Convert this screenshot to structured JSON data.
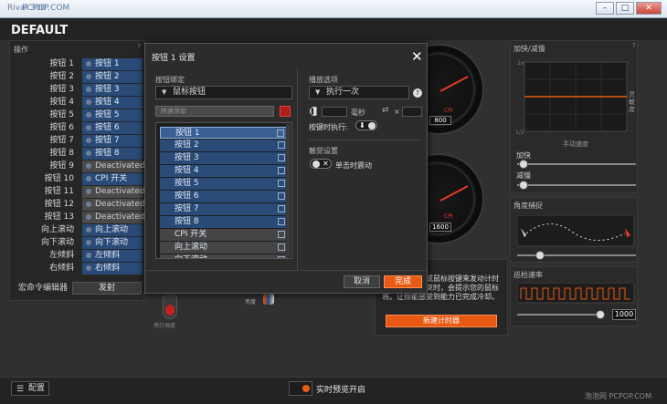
{
  "window": {
    "title": "Rival 300",
    "watermark_small": "PCPOP.COM",
    "watermark_big": "泡泡网 PCPOP.COM"
  },
  "profile": {
    "name": "DEFAULT"
  },
  "left_panel": {
    "header": "操作",
    "rows": [
      {
        "name": "按钮 1",
        "value": "按钮 1",
        "grey": false
      },
      {
        "name": "按钮 2",
        "value": "按钮 2",
        "grey": false
      },
      {
        "name": "按钮 3",
        "value": "按钮 3",
        "grey": false
      },
      {
        "name": "按钮 4",
        "value": "按钮 4",
        "grey": false
      },
      {
        "name": "按钮 5",
        "value": "按钮 5",
        "grey": false
      },
      {
        "name": "按钮 6",
        "value": "按钮 6",
        "grey": false
      },
      {
        "name": "按钮 7",
        "value": "按钮 7",
        "grey": false
      },
      {
        "name": "按钮 8",
        "value": "按钮 8",
        "grey": false
      },
      {
        "name": "按钮 9",
        "value": "Deactivated",
        "grey": true
      },
      {
        "name": "按钮 10",
        "value": "CPI 开关",
        "grey": false
      },
      {
        "name": "按钮 11",
        "value": "Deactivated",
        "grey": true
      },
      {
        "name": "按钮 12",
        "value": "Deactivated",
        "grey": true
      },
      {
        "name": "按钮 13",
        "value": "Deactivated",
        "grey": true
      },
      {
        "name": "向上滚动",
        "value": "向上滚动",
        "grey": false
      },
      {
        "name": "向下滚动",
        "value": "向下滚动",
        "grey": false
      },
      {
        "name": "左倾斜",
        "value": "左倾斜",
        "grey": false
      },
      {
        "name": "右倾斜",
        "value": "右倾斜",
        "grey": false
      }
    ],
    "macro_editor": "宏命令编辑器",
    "fire": "发射"
  },
  "dialog": {
    "title": "按钮 1 设置",
    "binding_label": "按钮绑定",
    "binding_value": "鼠标按钮",
    "search_placeholder": "快速添加",
    "list": [
      "按钮 1",
      "按钮 2",
      "按钮 3",
      "按钮 4",
      "按钮 5",
      "按钮 6",
      "按钮 7",
      "按钮 8",
      "CPI 开关",
      "向上滚动",
      "向下滚动"
    ],
    "playback_label": "播放选项",
    "playback_value": "执行一次",
    "ms_label": "毫秒",
    "times_label": "×",
    "exec_on_label": "按键时执行:",
    "haptic_label": "触觉设置",
    "haptic_value": "单击时震动",
    "cancel": "取消",
    "done": "完成"
  },
  "cpi": {
    "value1": "800",
    "value2": "1600",
    "unit": "CPI"
  },
  "accel": {
    "title": "加快/减慢",
    "axis_right": "灵敏度",
    "axis_bottom": "手动速度",
    "tick_top": "2x",
    "tick_bottom": "1/2",
    "accel_label": "加快",
    "decel_label": "减慢"
  },
  "angle": {
    "title": "角度捕捉"
  },
  "polling": {
    "title": "巡检速率",
    "value": "1000"
  },
  "timer": {
    "note": "选择一个按键或鼠标按键来发动计时器。当计时结束时，会提示您的鼠标将。让你能感觉到能力已完成冷却。",
    "new_timer": "新建计时器"
  },
  "lighting": {
    "label": "亮度",
    "label2": "亮灯强度"
  },
  "bottom": {
    "config": "配置",
    "preview": "实时预览开启"
  },
  "colors": {
    "accent": "#e85a13",
    "blue": "#2a4b78",
    "red": "#b11c1c"
  }
}
